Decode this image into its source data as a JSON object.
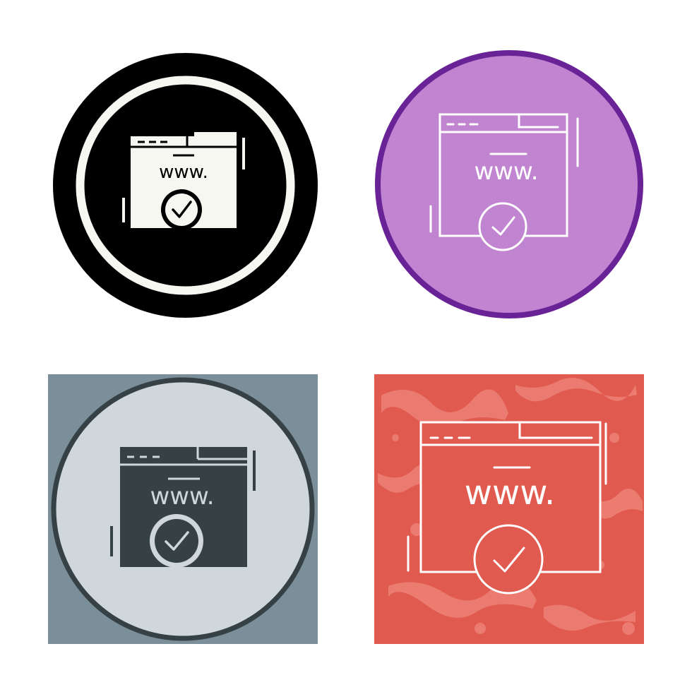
{
  "icon_set": {
    "name": "verified-website-icon-variants",
    "address_text": "www.",
    "variants": [
      {
        "style": "glyph-circle",
        "background": "#000000",
        "icon_color": "#f7f7f2",
        "ring_color": "#f7f7f2"
      },
      {
        "style": "line-circle",
        "background": "#c084d0",
        "icon_color": "#ffffff",
        "ring_color": "#6a2397"
      },
      {
        "style": "glyph-square",
        "background": "#7a8f9a",
        "icon_color": "#354144",
        "ring_color": "#354144",
        "circle_fill": "#cfd7dc"
      },
      {
        "style": "line-square-textured",
        "background": "#e05a4f",
        "icon_color": "#ffffff",
        "texture_color": "#f08a7e"
      }
    ]
  }
}
